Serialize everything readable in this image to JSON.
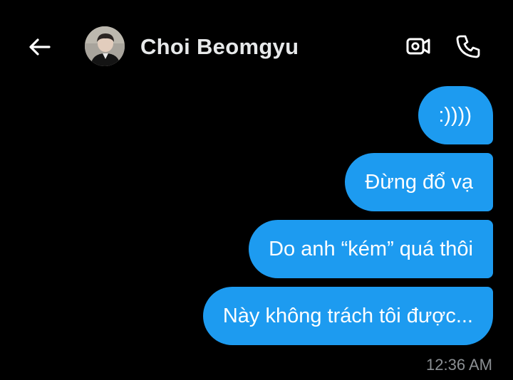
{
  "header": {
    "contact_name": "Choi Beomgyu",
    "back_icon": "arrow-left-icon",
    "video_icon": "video-camera-icon",
    "call_icon": "phone-icon"
  },
  "messages": [
    {
      "text": ":))))",
      "sender": "me"
    },
    {
      "text": "Đừng đổ vạ",
      "sender": "me"
    },
    {
      "text": "Do anh “kém” quá thôi",
      "sender": "me"
    },
    {
      "text": "Này không trách tôi được...",
      "sender": "me"
    }
  ],
  "last_timestamp": "12:36 AM",
  "colors": {
    "background": "#000000",
    "bubble": "#1d9bf0",
    "name_text": "#e7e9ea",
    "timestamp": "#8b8f93"
  }
}
